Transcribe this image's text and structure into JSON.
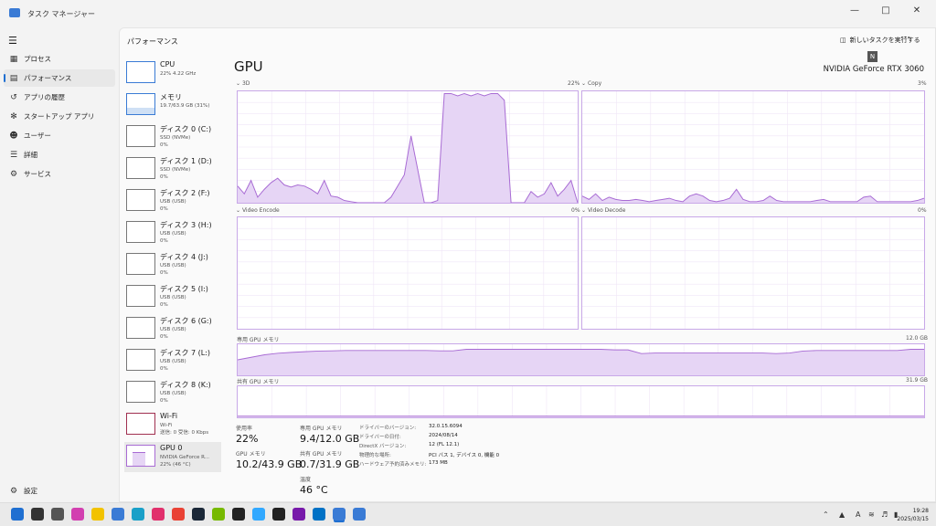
{
  "app": {
    "title": "タスク マネージャー"
  },
  "nav": {
    "items": [
      {
        "label": "プロセス",
        "icon": "grid-icon"
      },
      {
        "label": "パフォーマンス",
        "icon": "performance-icon"
      },
      {
        "label": "アプリの履歴",
        "icon": "history-icon"
      },
      {
        "label": "スタートアップ アプリ",
        "icon": "startup-icon"
      },
      {
        "label": "ユーザー",
        "icon": "users-icon"
      },
      {
        "label": "詳細",
        "icon": "details-icon"
      },
      {
        "label": "サービス",
        "icon": "services-icon"
      }
    ],
    "settings": "設定"
  },
  "header": {
    "title": "パフォーマンス",
    "run_task": "新しいタスクを実行する",
    "tooltip": "N"
  },
  "list": [
    {
      "name": "CPU",
      "sub": [
        "22% 4.22 GHz"
      ]
    },
    {
      "name": "メモリ",
      "sub": [
        "19.7/63.9 GB (31%)"
      ]
    },
    {
      "name": "ディスク 0 (C:)",
      "sub": [
        "SSD (NVMe)",
        "0%"
      ]
    },
    {
      "name": "ディスク 1 (D:)",
      "sub": [
        "SSD (NVMe)",
        "0%"
      ]
    },
    {
      "name": "ディスク 2 (F:)",
      "sub": [
        "USB (USB)",
        "0%"
      ]
    },
    {
      "name": "ディスク 3 (H:)",
      "sub": [
        "USB (USB)",
        "0%"
      ]
    },
    {
      "name": "ディスク 4 (J:)",
      "sub": [
        "USB (USB)",
        "0%"
      ]
    },
    {
      "name": "ディスク 5 (I:)",
      "sub": [
        "USB (USB)",
        "0%"
      ]
    },
    {
      "name": "ディスク 6 (G:)",
      "sub": [
        "USB (USB)",
        "0%"
      ]
    },
    {
      "name": "ディスク 7 (L:)",
      "sub": [
        "USB (USB)",
        "0%"
      ]
    },
    {
      "name": "ディスク 8 (K:)",
      "sub": [
        "USB (USB)",
        "0%"
      ]
    },
    {
      "name": "Wi-Fi",
      "sub": [
        "Wi-Fi",
        "送信: 0 受信: 0 Kbps"
      ]
    },
    {
      "name": "GPU 0",
      "sub": [
        "NVIDIA GeForce R...",
        "22% (46 °C)"
      ]
    }
  ],
  "gpu": {
    "title": "GPU",
    "model": "NVIDIA GeForce RTX 3060",
    "engines": [
      {
        "name": "3D",
        "pct": "22%"
      },
      {
        "name": "Copy",
        "pct": "3%"
      },
      {
        "name": "Video Encode",
        "pct": "0%"
      },
      {
        "name": "Video Decode",
        "pct": "0%"
      }
    ],
    "dedicated": {
      "label": "専用 GPU メモリ",
      "max": "12.0 GB"
    },
    "shared": {
      "label": "共有 GPU メモリ",
      "max": "31.9 GB"
    },
    "stats": {
      "util_label": "使用率",
      "util": "22%",
      "dedmem_label": "専用 GPU メモリ",
      "dedmem": "9.4/12.0 GB",
      "gpumem_label": "GPU メモリ",
      "gpumem": "10.2/43.9 GB",
      "sharedmem_label": "共有 GPU メモリ",
      "sharedmem": "0.7/31.9 GB",
      "temp_label": "温度",
      "temp": "46 °C"
    },
    "info": [
      {
        "k": "ドライバーのバージョン:",
        "v": "32.0.15.6094"
      },
      {
        "k": "ドライバーの日付:",
        "v": "2024/08/14"
      },
      {
        "k": "DirectX バージョン:",
        "v": "12 (FL 12.1)"
      },
      {
        "k": "物理的な場所:",
        "v": "PCI バス 1, デバイス 0, 機能 0"
      },
      {
        "k": "ハードウェア予約済みメモリ:",
        "v": "173 MB"
      }
    ]
  },
  "series": {
    "d3": [
      15,
      8,
      20,
      5,
      12,
      18,
      22,
      16,
      14,
      16,
      15,
      12,
      8,
      20,
      6,
      5,
      2,
      1,
      0,
      0,
      0,
      0,
      0,
      5,
      15,
      25,
      60,
      30,
      0,
      0,
      2,
      98,
      98,
      96,
      98,
      96,
      98,
      96,
      98,
      98,
      92,
      0,
      0,
      0,
      10,
      5,
      8,
      18,
      6,
      12,
      20,
      0
    ],
    "copy": [
      6,
      3,
      8,
      2,
      5,
      3,
      2,
      2,
      3,
      2,
      1,
      2,
      3,
      4,
      2,
      1,
      6,
      8,
      6,
      2,
      1,
      2,
      4,
      12,
      3,
      1,
      1,
      2,
      6,
      2,
      1,
      1,
      1,
      1,
      1,
      2,
      3,
      1,
      1,
      1,
      1,
      1,
      5,
      6,
      1,
      1,
      1,
      1,
      1,
      1,
      2,
      4
    ],
    "dedicated": [
      50,
      58,
      66,
      71,
      74,
      76,
      78,
      79,
      80,
      80,
      80,
      80,
      80,
      80,
      80,
      79,
      79,
      84,
      84,
      84,
      84,
      84,
      84,
      84,
      84,
      84,
      84,
      84,
      82,
      82,
      70,
      72,
      72,
      72,
      72,
      72,
      72,
      72,
      72,
      72,
      70,
      72,
      78,
      80,
      80,
      80,
      80,
      80,
      80,
      80,
      84,
      84
    ],
    "shared": [
      4,
      4,
      4,
      4,
      4,
      4,
      4,
      4,
      4,
      4,
      4,
      4,
      4,
      4,
      4,
      4,
      4,
      4,
      4,
      4,
      4,
      4,
      4,
      4,
      4,
      4,
      4,
      4,
      4,
      4,
      4,
      4,
      4,
      4,
      4,
      4,
      4,
      4,
      4,
      4,
      4,
      4,
      4,
      4,
      4,
      4,
      4,
      4,
      4,
      4,
      4,
      4
    ]
  },
  "taskbar": {
    "icons": [
      "start-icon",
      "search-icon",
      "taskview-icon",
      "copilot-icon",
      "explorer-icon",
      "store-icon",
      "edge-icon",
      "instagram-icon",
      "chrome-icon",
      "steam-icon",
      "nvidia-icon",
      "davinci-icon",
      "lightroom-icon",
      "app-icon",
      "onenote-icon",
      "intel-icon",
      "taskmanager-icon",
      "paint-icon"
    ]
  },
  "clock": {
    "time": "19:28",
    "date": "2025/03/15"
  },
  "colors": {
    "accent": "#a86bd4",
    "fill": "#e6d5f5",
    "selected_blue": "#1f6fd1"
  }
}
